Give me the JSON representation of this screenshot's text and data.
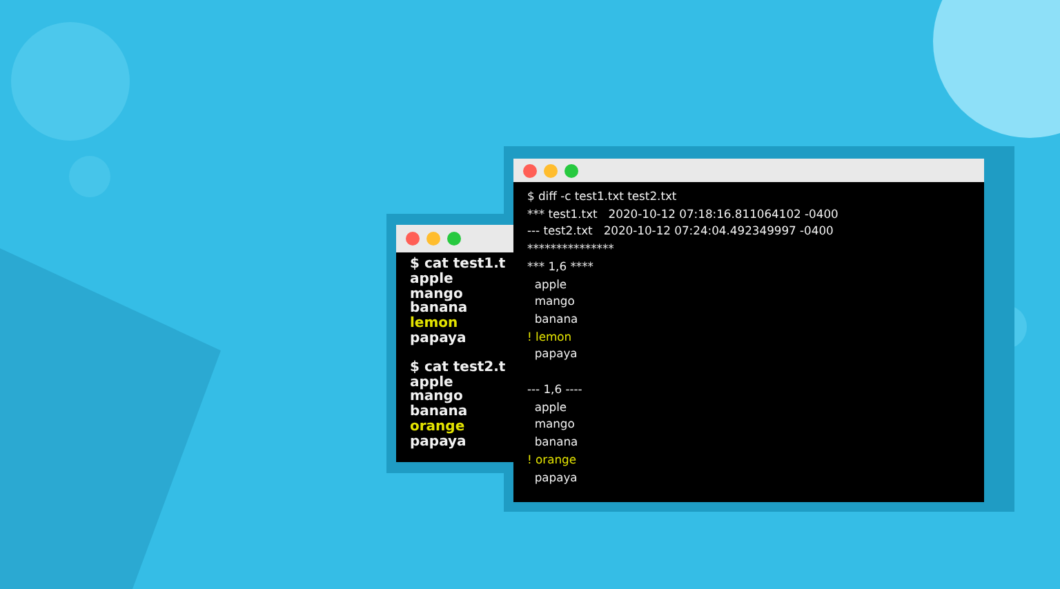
{
  "terminals": [
    {
      "blocks": [
        {
          "lines": [
            {
              "text": "$ cat test1.t",
              "highlight": false
            },
            {
              "text": "apple",
              "highlight": false
            },
            {
              "text": "mango",
              "highlight": false
            },
            {
              "text": "banana",
              "highlight": false
            },
            {
              "text": "lemon",
              "highlight": true
            },
            {
              "text": "papaya",
              "highlight": false
            }
          ]
        },
        {
          "lines": [
            {
              "text": "$ cat test2.t",
              "highlight": false
            },
            {
              "text": "apple",
              "highlight": false
            },
            {
              "text": "mango",
              "highlight": false
            },
            {
              "text": "banana",
              "highlight": false
            },
            {
              "text": "orange",
              "highlight": true
            },
            {
              "text": "papaya",
              "highlight": false
            }
          ]
        }
      ]
    },
    {
      "blocks": [
        {
          "lines": [
            {
              "text": "$ diff -c test1.txt test2.txt",
              "highlight": false
            },
            {
              "text": "*** test1.txt   2020-10-12 07:18:16.811064102 -0400",
              "highlight": false
            },
            {
              "text": "--- test2.txt   2020-10-12 07:24:04.492349997 -0400",
              "highlight": false
            },
            {
              "text": "***************",
              "highlight": false
            },
            {
              "text": "*** 1,6 ****",
              "highlight": false
            },
            {
              "text": "  apple",
              "highlight": false
            },
            {
              "text": "  mango",
              "highlight": false
            },
            {
              "text": "  banana",
              "highlight": false
            },
            {
              "text": "! lemon",
              "highlight": true
            },
            {
              "text": "  papaya",
              "highlight": false
            }
          ]
        },
        {
          "lines": [
            {
              "text": "--- 1,6 ----",
              "highlight": false
            },
            {
              "text": "  apple",
              "highlight": false
            },
            {
              "text": "  mango",
              "highlight": false
            },
            {
              "text": "  banana",
              "highlight": false
            },
            {
              "text": "! orange",
              "highlight": true
            },
            {
              "text": "  papaya",
              "highlight": false
            }
          ]
        }
      ]
    }
  ]
}
